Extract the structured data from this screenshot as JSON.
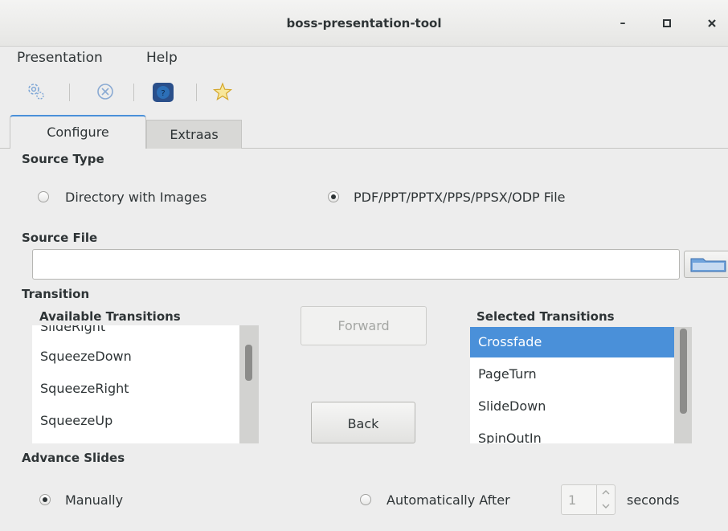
{
  "window": {
    "title": "boss-presentation-tool",
    "buttons": {
      "minimize": "–",
      "maximize": "▫",
      "close": "✕"
    }
  },
  "menubar": {
    "items": [
      "Presentation",
      "Help"
    ]
  },
  "toolbar": {
    "icons": [
      "gear-icon",
      "stop-icon",
      "help-icon",
      "star-icon"
    ],
    "colors": {
      "help": "#2c6fb7",
      "star": "#f5e08a"
    }
  },
  "tabs": [
    {
      "label": "Configure",
      "active": true
    },
    {
      "label": "Extraas",
      "active": false
    }
  ],
  "source_type": {
    "heading": "Source Type",
    "options": [
      {
        "label": "Directory with Images",
        "checked": false
      },
      {
        "label": "PDF/PPT/PPTX/PPS/PPSX/ODP File",
        "checked": true
      }
    ]
  },
  "source_file": {
    "heading": "Source File",
    "value": ""
  },
  "transition": {
    "heading": "Transition",
    "available": {
      "heading": "Available Transitions",
      "items": [
        "SlideRight",
        "SqueezeDown",
        "SqueezeRight",
        "SqueezeUp"
      ]
    },
    "selected": {
      "heading": "Selected Transitions",
      "items": [
        "Crossfade",
        "PageTurn",
        "SlideDown",
        "SpinOutIn"
      ],
      "selected_index": 0
    },
    "forward_label": "Forward",
    "back_label": "Back"
  },
  "advance": {
    "heading": "Advance Slides",
    "manual_label": "Manually",
    "manual_checked": true,
    "auto_label": "Automatically After",
    "auto_checked": false,
    "seconds_value": "1",
    "seconds_label": "seconds"
  },
  "colors": {
    "accent": "#4a90d9",
    "background": "#ededed"
  }
}
